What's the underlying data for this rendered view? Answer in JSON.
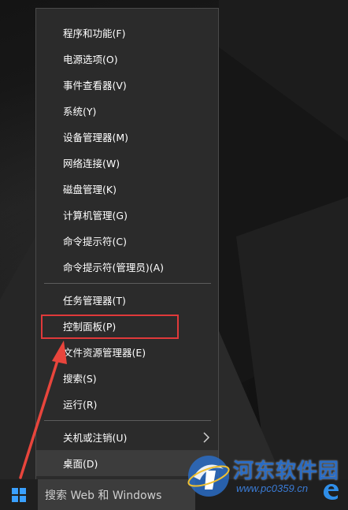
{
  "menu": {
    "items": [
      {
        "label": "程序和功能(F)"
      },
      {
        "label": "电源选项(O)"
      },
      {
        "label": "事件查看器(V)"
      },
      {
        "label": "系统(Y)"
      },
      {
        "label": "设备管理器(M)"
      },
      {
        "label": "网络连接(W)"
      },
      {
        "label": "磁盘管理(K)"
      },
      {
        "label": "计算机管理(G)"
      },
      {
        "label": "命令提示符(C)"
      },
      {
        "label": "命令提示符(管理员)(A)"
      },
      {
        "label": "任务管理器(T)"
      },
      {
        "label": "控制面板(P)"
      },
      {
        "label": "文件资源管理器(E)"
      },
      {
        "label": "搜索(S)"
      },
      {
        "label": "运行(R)"
      },
      {
        "label": "关机或注销(U)",
        "submenu_icon": "chevron-right-icon"
      },
      {
        "label": "桌面(D)"
      }
    ],
    "highlighted_item": "控制面板(P)",
    "hovered_item": "桌面(D)"
  },
  "taskbar": {
    "start_icon": "windows-logo-icon",
    "search_placeholder": "搜索 Web 和 Windows",
    "pinned_icon": "edge-browser-icon"
  },
  "watermark": {
    "title": "河东软件园",
    "url": "www.pc0359.cn"
  },
  "colors": {
    "menu_bg": "#2b2b2b",
    "highlight_box": "#e0393a",
    "arrow": "#e8453c",
    "watermark": "#2a6cc4"
  }
}
